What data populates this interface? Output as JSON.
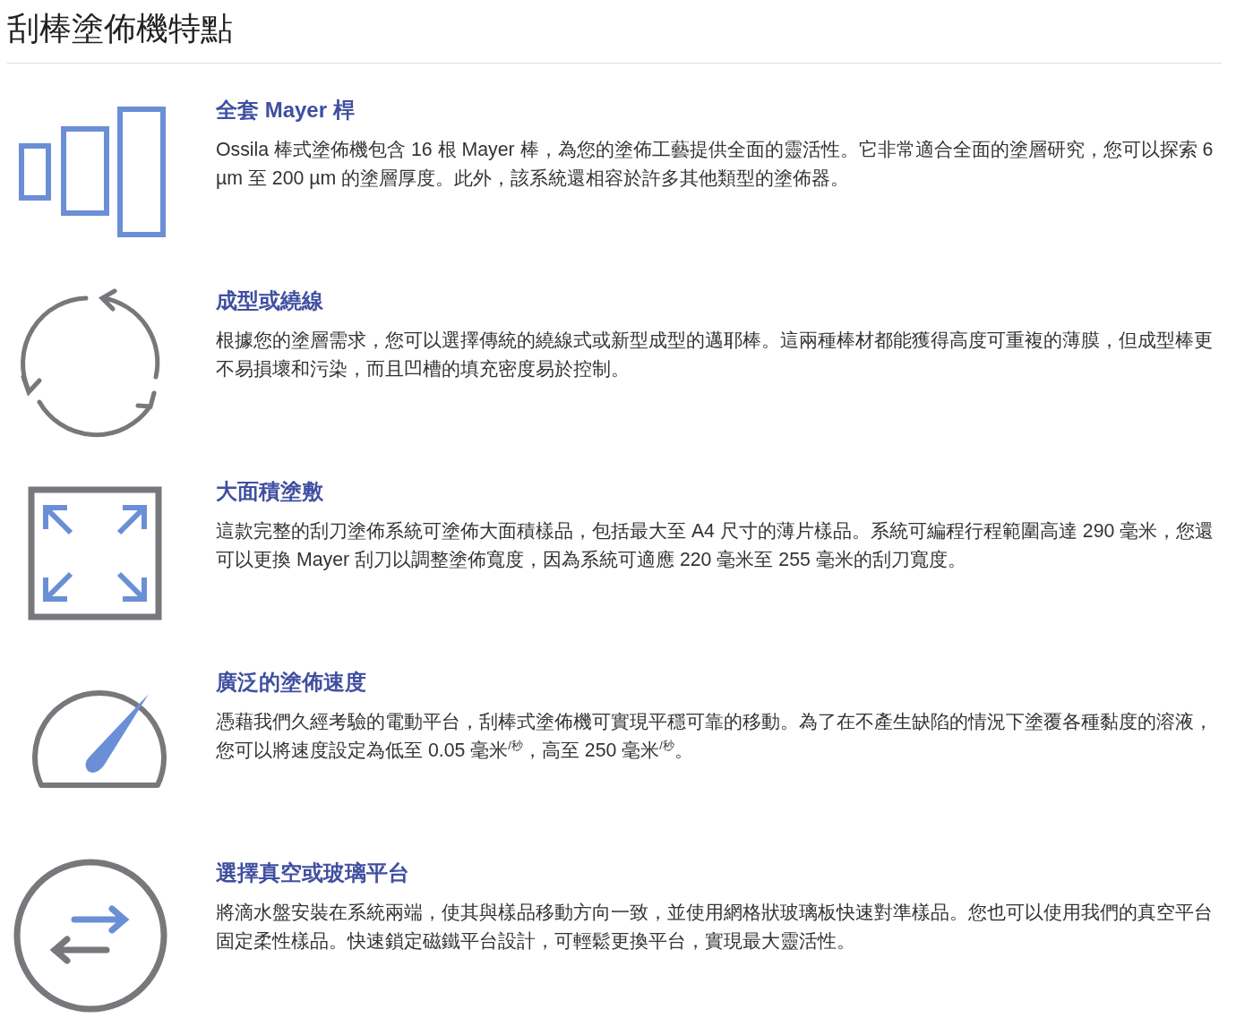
{
  "title": "刮棒塗佈機特點",
  "features": [
    {
      "heading": "全套 Mayer 桿",
      "text": "Ossila 棒式塗佈機包含 16 根 Mayer 棒，為您的塗佈工藝提供全面的靈活性。它非常適合全面的塗層研究，您可以探索 6 µm 至 200 µm 的塗層厚度。此外，該系統還相容於許多其他類型的塗佈器。"
    },
    {
      "heading": "成型或繞線",
      "text": "根據您的塗層需求，您可以選擇傳統的繞線式或新型成型的邁耶棒。這兩種棒材都能獲得高度可重複的薄膜，但成型棒更不易損壞和污染，而且凹槽的填充密度易於控制。"
    },
    {
      "heading": "大面積塗敷",
      "text": "這款完整的刮刀塗佈系統可塗佈大面積樣品，包括最大至 A4 尺寸的薄片樣品。系統可編程行程範圍高達 290 毫米，您還可以更換 Mayer 刮刀以調整塗佈寬度，因為系統可適應 220 毫米至 255 毫米的刮刀寬度。"
    },
    {
      "heading": "廣泛的塗佈速度",
      "text": "憑藉我們久經考驗的電動平台，刮棒式塗佈機可實現平穩可靠的移動。為了在不產生缺陷的情況下塗覆各種黏度的溶液，您可以將速度設定為低至 0.05 毫米$^{/秒}$，高至 250 毫米$^{/秒}$。"
    },
    {
      "heading": "選擇真空或玻璃平台",
      "text": "將滴水盤安裝在系統兩端，使其與樣品移動方向一致，並使用網格狀玻璃板快速對準樣品。您也可以使用我們的真空平台固定柔性樣品。快速鎖定磁鐵平台設計，可輕鬆更換平台，實現最大靈活性。"
    }
  ]
}
